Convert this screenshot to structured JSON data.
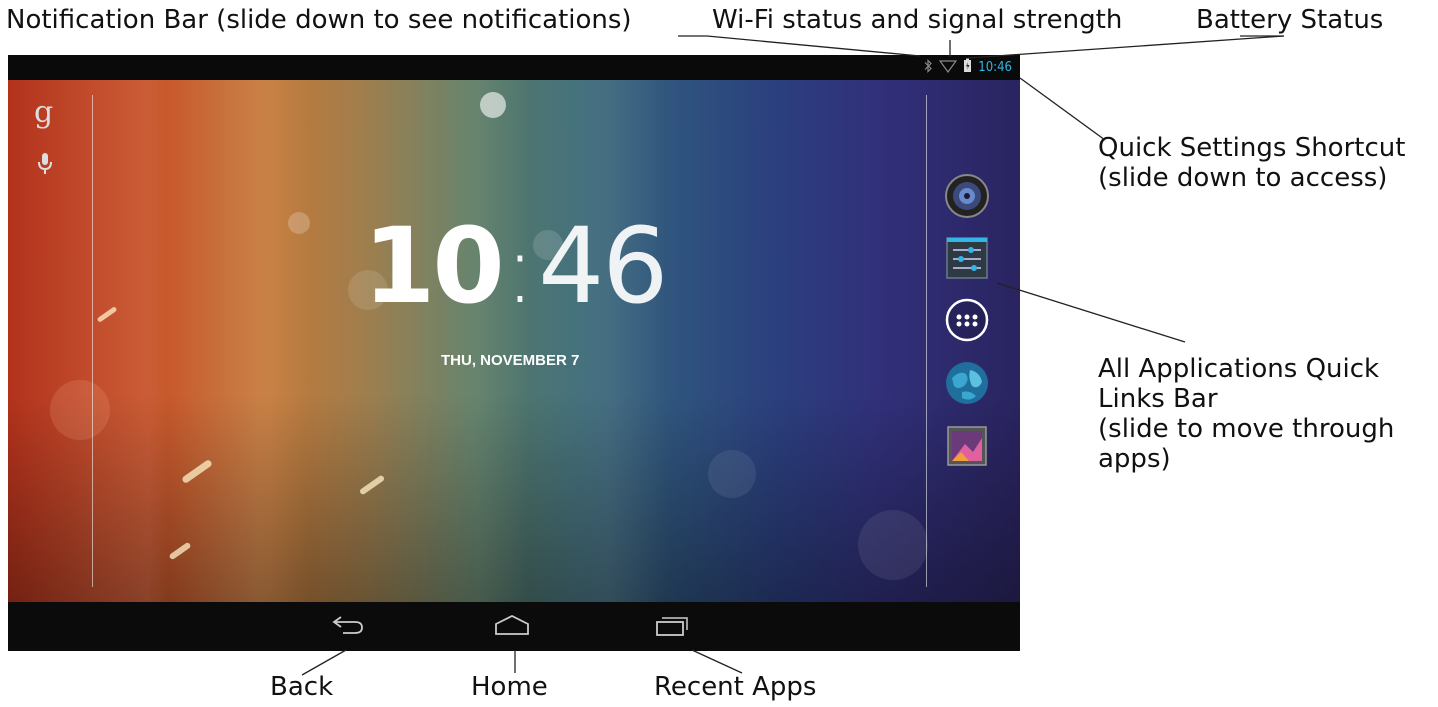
{
  "annotations": {
    "notification_bar": "Notification Bar (slide down to see notifications)",
    "wifi_status": "Wi-Fi status and signal strength",
    "battery_status": "Battery Status",
    "quick_settings": [
      "Quick Settings Shortcut",
      "(slide down to access)"
    ],
    "all_apps": [
      "All Applications Quick",
      "Links Bar",
      "(slide to move through",
      "apps)"
    ],
    "back": "Back",
    "home": "Home",
    "recent_apps": "Recent Apps"
  },
  "status_bar": {
    "time": "10:46",
    "icons": [
      "bluetooth-icon",
      "wifi-icon",
      "battery-icon"
    ],
    "accent_color": "#33b5e5"
  },
  "home_screen": {
    "clock_hours": "10",
    "clock_separator": ":",
    "clock_minutes": "46",
    "date": "THU, NOVEMBER 7",
    "search_logo": "g",
    "dock_icons": [
      "music-icon",
      "settings-icon",
      "all-apps-icon",
      "browser-icon",
      "gallery-icon"
    ]
  },
  "navigation": {
    "buttons": [
      "back-icon",
      "home-icon",
      "recent-apps-icon"
    ]
  }
}
